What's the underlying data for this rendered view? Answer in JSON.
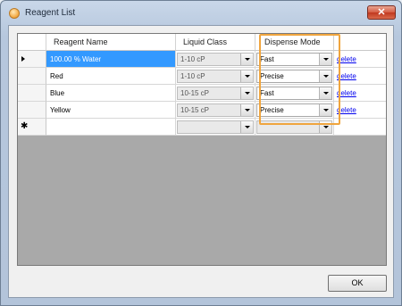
{
  "window": {
    "title": "Reagent List",
    "close_glyph": "✕"
  },
  "grid": {
    "columns": [
      "Reagent Name",
      "Liquid Class",
      "Dispense Mode"
    ],
    "rows": [
      {
        "name": "100.00 % Water",
        "liquid_class": "1-10 cP",
        "dispense_mode": "Fast",
        "action": "delete",
        "selected": true
      },
      {
        "name": "Red",
        "liquid_class": "1-10 cP",
        "dispense_mode": "Precise",
        "action": "delete"
      },
      {
        "name": "Blue",
        "liquid_class": "10-15 cP",
        "dispense_mode": "Fast",
        "action": "delete"
      },
      {
        "name": "Yellow",
        "liquid_class": "10-15 cP",
        "dispense_mode": "Precise",
        "action": "delete"
      }
    ],
    "new_row_marker": "✱",
    "current_row_icon": "row-pointer-icon"
  },
  "buttons": {
    "ok": "OK"
  },
  "colors": {
    "selection": "#3399ff",
    "highlight_border": "#f0a53e",
    "link": "#0000ee"
  }
}
